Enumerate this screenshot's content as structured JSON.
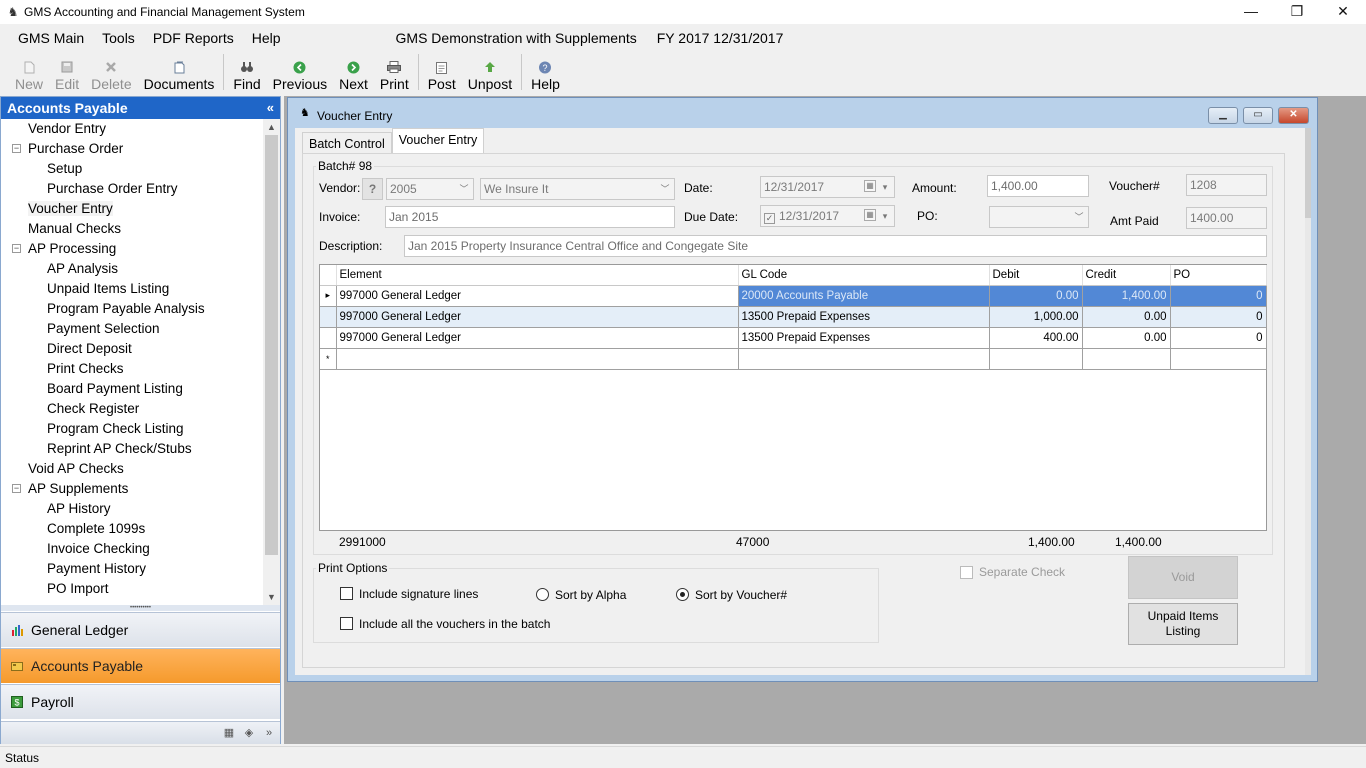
{
  "window": {
    "title": "GMS Accounting and Financial Management System",
    "minimize": "—",
    "restore": "❐",
    "close": "✕"
  },
  "menu": {
    "items": [
      "GMS Main",
      "Tools",
      "PDF Reports",
      "Help"
    ],
    "company": "GMS Demonstration with Supplements",
    "fiscal_year": "FY 2017 12/31/2017"
  },
  "toolbar": {
    "new": "New",
    "edit": "Edit",
    "delete": "Delete",
    "documents": "Documents",
    "find": "Find",
    "previous": "Previous",
    "next": "Next",
    "print": "Print",
    "post": "Post",
    "unpost": "Unpost",
    "help": "Help"
  },
  "nav": {
    "header": "Accounts Payable",
    "collapse": "«",
    "tree": [
      {
        "label": "Vendor Entry",
        "level": 0
      },
      {
        "label": "Purchase Order",
        "level": 0,
        "expander": "−"
      },
      {
        "label": "Setup",
        "level": 1
      },
      {
        "label": "Purchase Order Entry",
        "level": 1
      },
      {
        "label": "Voucher Entry",
        "level": 0,
        "selected": true
      },
      {
        "label": "Manual Checks",
        "level": 0
      },
      {
        "label": "AP Processing",
        "level": 0,
        "expander": "−"
      },
      {
        "label": "AP Analysis",
        "level": 1
      },
      {
        "label": "Unpaid Items Listing",
        "level": 1
      },
      {
        "label": "Program Payable Analysis",
        "level": 1
      },
      {
        "label": "Payment Selection",
        "level": 1
      },
      {
        "label": "Direct Deposit",
        "level": 1
      },
      {
        "label": "Print Checks",
        "level": 1
      },
      {
        "label": "Board Payment Listing",
        "level": 1
      },
      {
        "label": "Check Register",
        "level": 1
      },
      {
        "label": "Program Check Listing",
        "level": 1
      },
      {
        "label": "Reprint AP Check/Stubs",
        "level": 1
      },
      {
        "label": "Void AP Checks",
        "level": 0
      },
      {
        "label": "AP Supplements",
        "level": 0,
        "expander": "−"
      },
      {
        "label": "AP History",
        "level": 1
      },
      {
        "label": "Complete 1099s",
        "level": 1
      },
      {
        "label": "Invoice Checking",
        "level": 1
      },
      {
        "label": "Payment History",
        "level": 1
      },
      {
        "label": "PO Import",
        "level": 1
      }
    ],
    "modules": [
      {
        "label": "General Ledger",
        "icon": "general-ledger-icon",
        "active": false
      },
      {
        "label": "Accounts Payable",
        "icon": "accounts-payable-icon",
        "active": true
      },
      {
        "label": "Payroll",
        "icon": "payroll-icon",
        "active": false
      }
    ]
  },
  "voucher_window": {
    "title": "Voucher Entry",
    "tabs": [
      "Batch Control",
      "Voucher Entry"
    ],
    "active_tab": "Voucher Entry",
    "batch_label": "Batch# 98",
    "vendor_label": "Vendor:",
    "vendor_lookup": "?",
    "vendor_code": "2005",
    "vendor_name": "We Insure It",
    "date_label": "Date:",
    "date_value": "12/31/2017",
    "amount_label": "Amount:",
    "amount_value": "1,400.00",
    "voucher_no_label": "Voucher#",
    "voucher_no_value": "1208",
    "invoice_label": "Invoice:",
    "invoice_value": "Jan 2015",
    "due_date_label": "Due Date:",
    "due_date_value": "12/31/2017",
    "po_label": "PO:",
    "po_value": "",
    "amt_paid_label": "Amt Paid",
    "amt_paid_value": "1400.00",
    "description_label": "Description:",
    "description_value": "Jan 2015 Property Insurance Central Office and Congegate Site"
  },
  "grid": {
    "columns": [
      "Element",
      "GL Code",
      "Debit",
      "Credit",
      "PO"
    ],
    "rows": [
      {
        "marker": "▸",
        "element": "997000 General Ledger",
        "gl_code": "20000 Accounts Payable",
        "debit": "0.00",
        "credit": "1,400.00",
        "po": "0"
      },
      {
        "marker": "",
        "element": "997000 General Ledger",
        "gl_code": "13500 Prepaid Expenses",
        "debit": "1,000.00",
        "credit": "0.00",
        "po": "0"
      },
      {
        "marker": "",
        "element": "997000 General Ledger",
        "gl_code": "13500 Prepaid Expenses",
        "debit": "400.00",
        "credit": "0.00",
        "po": "0"
      }
    ],
    "new_row_marker": "*",
    "totals": {
      "element": "2991000",
      "gl_code": "47000",
      "debit": "1,400.00",
      "credit": "1,400.00"
    }
  },
  "print_options": {
    "title": "Print Options",
    "include_signature_lines": "Include signature lines",
    "include_all_vouchers": "Include all the vouchers in the batch",
    "sort_by_alpha": "Sort by Alpha",
    "sort_by_voucher": "Sort by Voucher#",
    "selected_sort": "Sort by Voucher#"
  },
  "actions": {
    "separate_check": "Separate Check",
    "void": "Void",
    "unpaid_items_listing": "Unpaid Items Listing"
  },
  "status": {
    "text": "Status"
  }
}
